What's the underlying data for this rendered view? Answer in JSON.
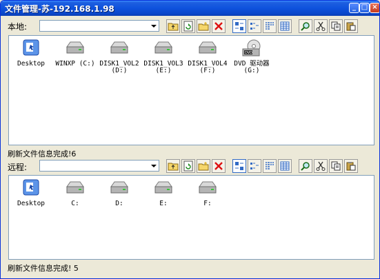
{
  "window": {
    "title": "文件管理-苏-192.168.1.98",
    "minimize": "_",
    "maximize": "□",
    "close": "×"
  },
  "local": {
    "label": "本地:",
    "path_value": "",
    "items": [
      {
        "label": "Desktop",
        "sub": "",
        "icon": "desktop-icon"
      },
      {
        "label": "WINXP (C:)",
        "sub": "",
        "icon": "drive-icon"
      },
      {
        "label": "DISK1_VOL2",
        "sub": "(D:)",
        "icon": "drive-icon"
      },
      {
        "label": "DISK1_VOL3",
        "sub": "(E:)",
        "icon": "drive-icon"
      },
      {
        "label": "DISK1_VOL4",
        "sub": "(F:)",
        "icon": "drive-icon"
      },
      {
        "label": "DVD 驱动器",
        "sub": "(G:)",
        "icon": "dvd-drive-icon"
      }
    ],
    "status": "刷新文件信息完成!6"
  },
  "remote": {
    "label": "远程:",
    "path_value": "",
    "items": [
      {
        "label": "Desktop",
        "sub": "",
        "icon": "desktop-icon"
      },
      {
        "label": "C:",
        "sub": "",
        "icon": "drive-icon"
      },
      {
        "label": "D:",
        "sub": "",
        "icon": "drive-icon"
      },
      {
        "label": "E:",
        "sub": "",
        "icon": "drive-icon"
      },
      {
        "label": "F:",
        "sub": "",
        "icon": "drive-icon"
      }
    ],
    "status": "刷新文件信息完成! 5"
  },
  "toolbar_icons": [
    "up-folder-icon",
    "refresh-icon",
    "new-folder-icon",
    "delete-icon",
    "large-icons-view-icon",
    "small-icons-view-icon",
    "list-view-icon",
    "details-view-icon",
    "search-icon",
    "cut-icon",
    "copy-icon",
    "paste-icon"
  ],
  "colors": {
    "titlebar": "#0A46C8",
    "face": "#ECE9D8",
    "border": "#7F9DB9"
  }
}
